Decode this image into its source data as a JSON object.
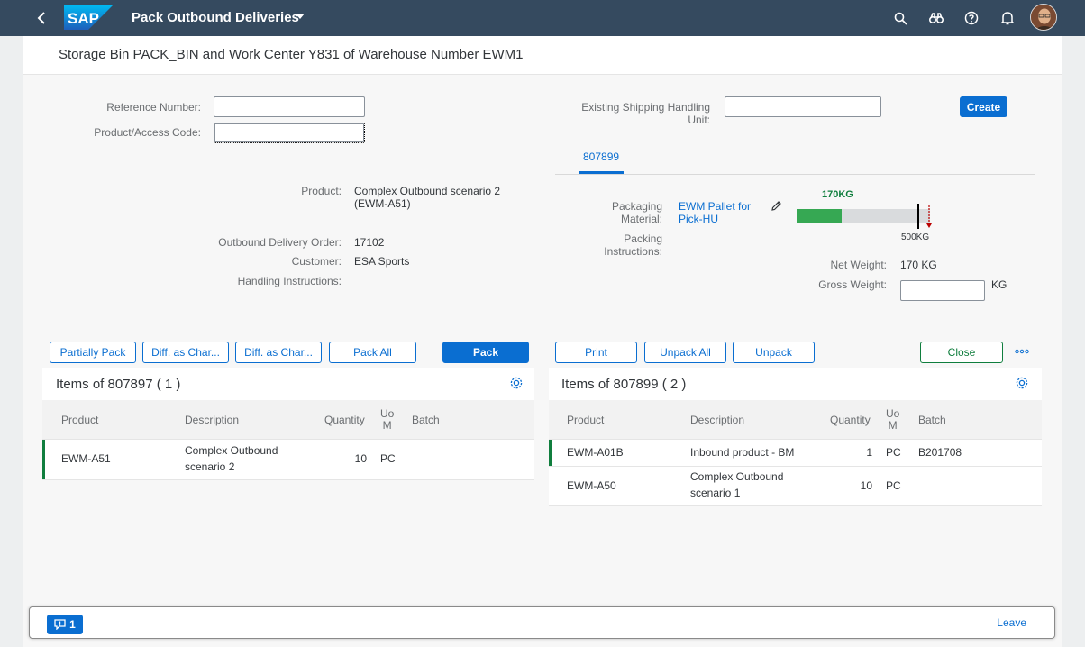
{
  "shell": {
    "title": "Pack Outbound Deliveries",
    "logo_text": "SAP"
  },
  "page": {
    "title": "Storage Bin PACK_BIN and Work Center Y831 of Warehouse Number EWM1"
  },
  "form": {
    "reference_label": "Reference Number:",
    "reference_value": "",
    "product_code_label": "Product/Access Code:",
    "product_code_value": "",
    "existing_hu_label_1": "Existing Shipping Handling",
    "existing_hu_label_2": "Unit:",
    "existing_hu_value": "",
    "create_label": "Create"
  },
  "details": {
    "product_label": "Product:",
    "product_value_1": "Complex Outbound scenario 2",
    "product_value_2": "(EWM-A51)",
    "odo_label": "Outbound Delivery Order:",
    "odo_value": "17102",
    "customer_label": "Customer:",
    "customer_value": "ESA Sports",
    "handling_label": "Handling Instructions:",
    "handling_value": ""
  },
  "hu": {
    "tab_label": "807899",
    "packaging_material_label_1": "Packaging",
    "packaging_material_label_2": "Material:",
    "packaging_material_value_1": "EWM Pallet for",
    "packaging_material_value_2": "Pick-HU",
    "packing_instr_label_1": "Packing",
    "packing_instr_label_2": "Instructions:",
    "weight_current_label": "170KG",
    "weight_max_label": "500KG",
    "weight_fraction": 0.34,
    "net_weight_label": "Net Weight:",
    "net_weight_value": "170 KG",
    "gross_weight_label": "Gross Weight:",
    "gross_weight_value": "",
    "gross_weight_unit": "KG"
  },
  "left_toolbar": {
    "partially_pack": "Partially Pack",
    "diff_char_1": "Diff. as Char...",
    "diff_char_2": "Diff. as Char...",
    "pack_all": "Pack All",
    "pack": "Pack"
  },
  "right_toolbar": {
    "print": "Print",
    "unpack_all": "Unpack All",
    "unpack": "Unpack",
    "close": "Close"
  },
  "left_table": {
    "title": "Items of 807897 ( 1 )",
    "headers": [
      "Product",
      "Description",
      "Quantity",
      "Uo",
      "M",
      "Batch"
    ],
    "rows": [
      {
        "product": "EWM-A51",
        "desc1": "Complex Outbound",
        "desc2": "scenario 2",
        "qty": "10",
        "uom": "PC",
        "batch": ""
      }
    ]
  },
  "right_table": {
    "title": "Items of 807899 ( 2 )",
    "headers": [
      "Product",
      "Description",
      "Quantity",
      "Uo",
      "M",
      "Batch"
    ],
    "rows": [
      {
        "product": "EWM-A01B",
        "desc1": "Inbound product - BM",
        "desc2": "",
        "qty": "1",
        "uom": "PC",
        "batch": "B201708"
      },
      {
        "product": "EWM-A50",
        "desc1": "Complex Outbound",
        "desc2": "scenario 1",
        "qty": "10",
        "uom": "PC",
        "batch": ""
      }
    ]
  },
  "footer": {
    "message_count": "1",
    "leave_label": "Leave"
  },
  "colors": {
    "shell": "#354a5f",
    "accent": "#0a6ed1",
    "positive": "#107e3e",
    "weight_fill": "#36a853"
  }
}
